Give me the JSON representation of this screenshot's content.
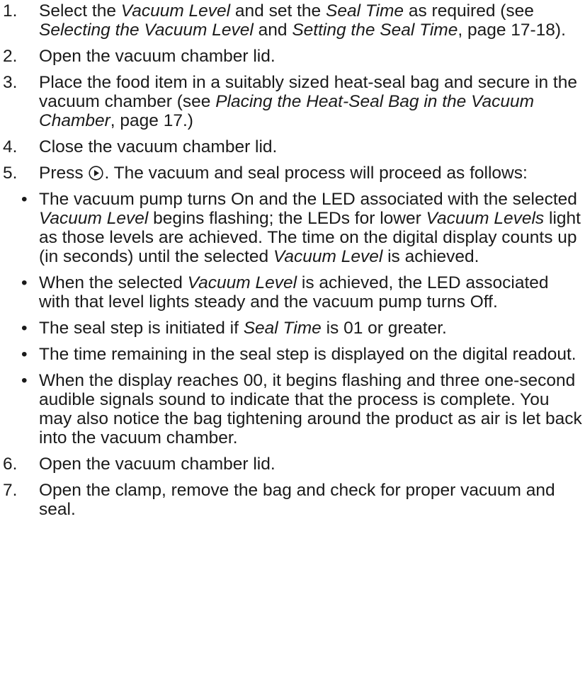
{
  "steps": [
    {
      "number": "1.",
      "runs": [
        {
          "text": "Select the ",
          "italic": false
        },
        {
          "text": "Vacuum Level",
          "italic": true
        },
        {
          "text": " and set the ",
          "italic": false
        },
        {
          "text": "Seal Time",
          "italic": true
        },
        {
          "text": " as required (see ",
          "italic": false
        },
        {
          "text": "Selecting the Vacuum Level",
          "italic": true
        },
        {
          "text": " and ",
          "italic": false
        },
        {
          "text": "Setting the Seal Time",
          "italic": true
        },
        {
          "text": ", page 17-18).",
          "italic": false
        }
      ]
    },
    {
      "number": "2.",
      "runs": [
        {
          "text": "Open the vacuum chamber lid.",
          "italic": false
        }
      ]
    },
    {
      "number": "3.",
      "runs": [
        {
          "text": "Place the food item in a suitably sized heat-seal bag and secure in the vacuum chamber (see ",
          "italic": false
        },
        {
          "text": "Placing the Heat-Seal Bag in the Vacuum Chamber",
          "italic": true
        },
        {
          "text": ", page 17.)",
          "italic": false
        }
      ]
    },
    {
      "number": "4.",
      "runs": [
        {
          "text": "Close the vacuum chamber lid.",
          "italic": false
        }
      ]
    },
    {
      "number": "5.",
      "runs": [
        {
          "text": "Press ",
          "italic": false
        },
        {
          "icon": "play-circle-icon"
        },
        {
          "text": ". The vacuum and seal process will proceed as follows:",
          "italic": false
        }
      ],
      "bullets": [
        [
          {
            "text": "The vacuum pump turns On and the LED associated with the selected ",
            "italic": false
          },
          {
            "text": "Vacuum Level",
            "italic": true
          },
          {
            "text": " begins flashing; the LEDs for lower ",
            "italic": false
          },
          {
            "text": "Vacuum Levels",
            "italic": true
          },
          {
            "text": " light as those levels are achieved. The time on the digital display counts up (in seconds) until the selected ",
            "italic": false
          },
          {
            "text": "Vacuum Level",
            "italic": true
          },
          {
            "text": " is achieved.",
            "italic": false
          }
        ],
        [
          {
            "text": "When the selected ",
            "italic": false
          },
          {
            "text": "Vacuum Level",
            "italic": true
          },
          {
            "text": " is achieved, the LED associated with that level lights steady and the vacuum pump turns Off.",
            "italic": false
          }
        ],
        [
          {
            "text": "The seal step is initiated if ",
            "italic": false
          },
          {
            "text": "Seal Time",
            "italic": true
          },
          {
            "text": " is 01 or greater.",
            "italic": false
          }
        ],
        [
          {
            "text": "The time remaining in the seal step is displayed on the digital readout.",
            "italic": false
          }
        ],
        [
          {
            "text": "When the display reaches 00, it begins flashing and three one-second audible signals sound to indicate that the process is complete. You may also notice the bag tightening around the product as air is let back into the vacuum chamber.",
            "italic": false
          }
        ]
      ]
    },
    {
      "number": "6.",
      "runs": [
        {
          "text": "Open the vacuum chamber lid.",
          "italic": false
        }
      ]
    },
    {
      "number": "7.",
      "runs": [
        {
          "text": "Open the clamp, remove the bag and check for proper vacuum and seal.",
          "italic": false
        }
      ]
    }
  ],
  "bullet_char": "•"
}
